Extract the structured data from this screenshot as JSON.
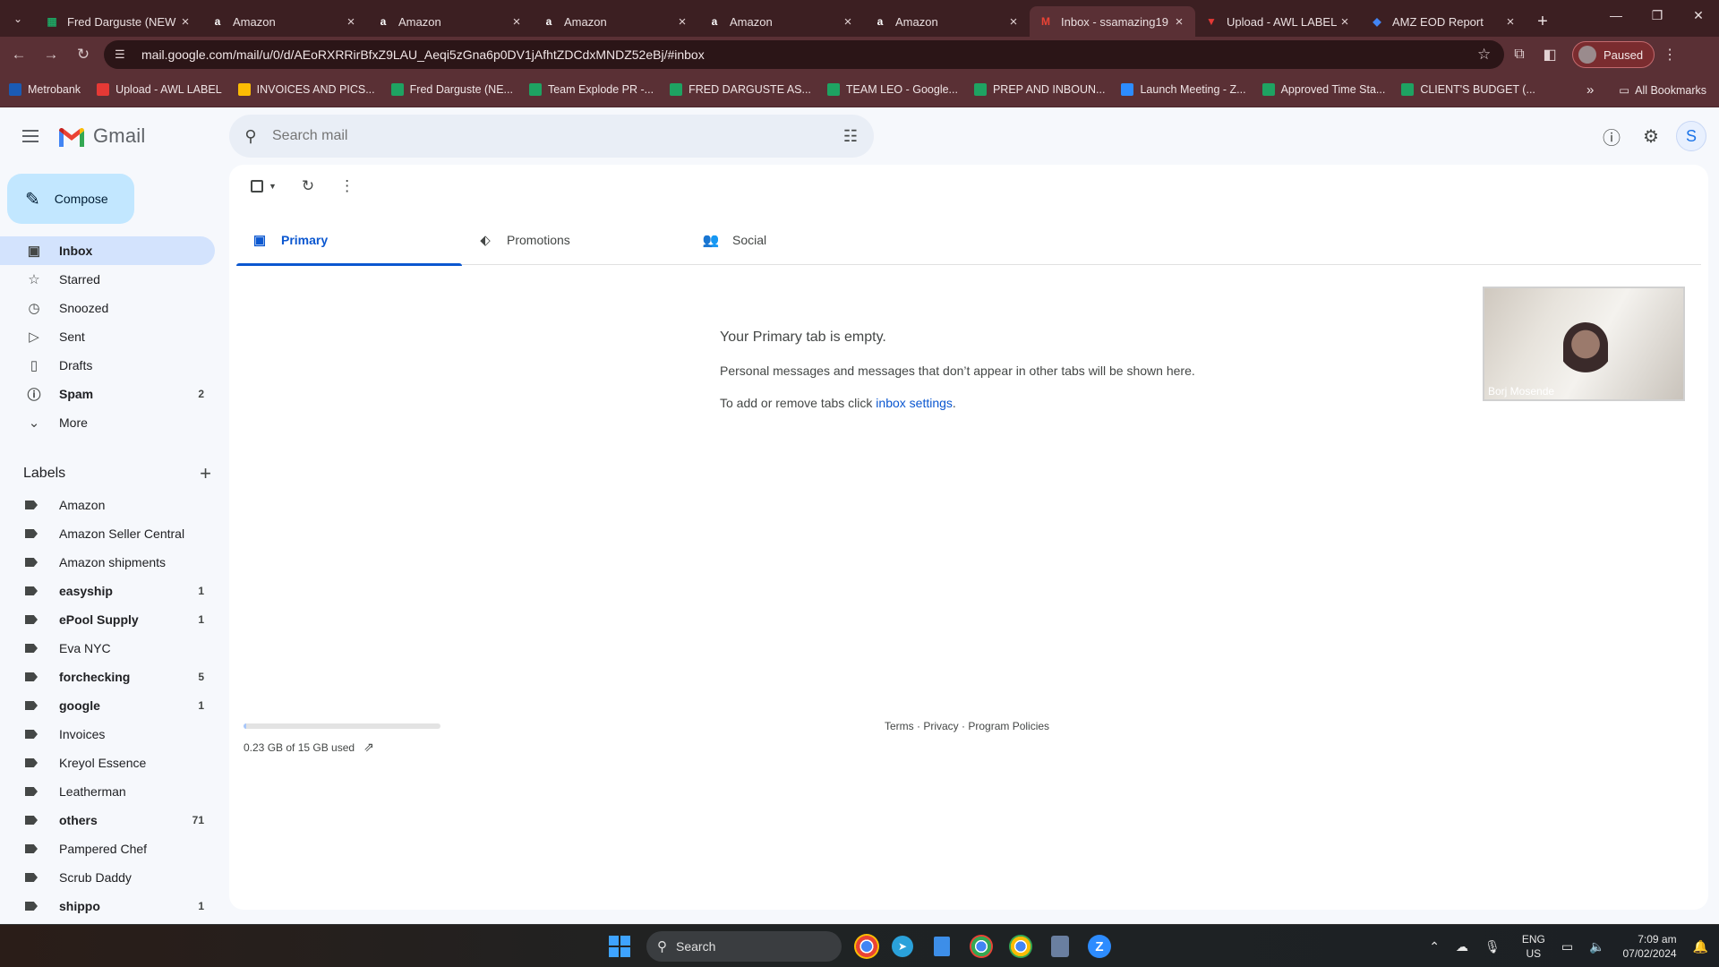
{
  "browser": {
    "tabs": [
      {
        "title": "Fred Darguste (NEW",
        "favicon": "sheets-icon",
        "color": "#1ea362",
        "active": false
      },
      {
        "title": "Amazon",
        "favicon": "amazon-icon",
        "color": "#ffffff",
        "active": false
      },
      {
        "title": "Amazon",
        "favicon": "amazon-icon",
        "color": "#ffffff",
        "active": false
      },
      {
        "title": "Amazon",
        "favicon": "amazon-icon",
        "color": "#ffffff",
        "active": false
      },
      {
        "title": "Amazon",
        "favicon": "amazon-icon",
        "color": "#ffffff",
        "active": false
      },
      {
        "title": "Amazon",
        "favicon": "amazon-icon",
        "color": "#ffffff",
        "active": false
      },
      {
        "title": "Inbox - ssamazing19",
        "favicon": "gmail-icon",
        "color": "#ea4335",
        "active": true
      },
      {
        "title": "Upload - AWL LABEL",
        "favicon": "awl-icon",
        "color": "#e53935",
        "active": false
      },
      {
        "title": "AMZ EOD Report",
        "favicon": "apps-script-icon",
        "color": "#4285f4",
        "active": false
      }
    ],
    "url": "mail.google.com/mail/u/0/d/AEoRXRRirBfxZ9LAU_Aeqi5zGna6p0DV1jAfhtZDCdxMNDZ52eBj/#inbox",
    "profile_status": "Paused",
    "bookmarks": [
      {
        "label": "Metrobank",
        "color": "#1a5bb5"
      },
      {
        "label": "Upload - AWL LABEL",
        "color": "#e53935"
      },
      {
        "label": "INVOICES AND PICS...",
        "color": "#fbbc04"
      },
      {
        "label": "Fred Darguste (NE...",
        "color": "#1ea362"
      },
      {
        "label": "Team Explode PR -...",
        "color": "#1ea362"
      },
      {
        "label": "FRED DARGUSTE AS...",
        "color": "#1ea362"
      },
      {
        "label": "TEAM LEO - Google...",
        "color": "#1ea362"
      },
      {
        "label": "PREP AND INBOUN...",
        "color": "#1ea362"
      },
      {
        "label": "Launch Meeting - Z...",
        "color": "#2d8cff"
      },
      {
        "label": "Approved Time Sta...",
        "color": "#1ea362"
      },
      {
        "label": "CLIENT'S BUDGET (...",
        "color": "#1ea362"
      }
    ],
    "all_bookmarks": "All Bookmarks"
  },
  "gmail": {
    "logo_text": "Gmail",
    "search_placeholder": "Search mail",
    "account_initial": "S",
    "compose": "Compose",
    "nav": [
      {
        "label": "Inbox",
        "icon": "inbox-icon",
        "glyph": "▣",
        "count": "",
        "active": true,
        "bold": true
      },
      {
        "label": "Starred",
        "icon": "star-icon",
        "glyph": "☆",
        "count": "",
        "active": false,
        "bold": false
      },
      {
        "label": "Snoozed",
        "icon": "clock-icon",
        "glyph": "◷",
        "count": "",
        "active": false,
        "bold": false
      },
      {
        "label": "Sent",
        "icon": "send-icon",
        "glyph": "▷",
        "count": "",
        "active": false,
        "bold": false
      },
      {
        "label": "Drafts",
        "icon": "draft-icon",
        "glyph": "▯",
        "count": "",
        "active": false,
        "bold": false
      },
      {
        "label": "Spam",
        "icon": "spam-icon",
        "glyph": "ⓘ",
        "count": "2",
        "active": false,
        "bold": true
      },
      {
        "label": "More",
        "icon": "chevron-down-icon",
        "glyph": "⌄",
        "count": "",
        "active": false,
        "bold": false
      }
    ],
    "labels_title": "Labels",
    "labels": [
      {
        "label": "Amazon",
        "count": "",
        "bold": false
      },
      {
        "label": "Amazon Seller Central",
        "count": "",
        "bold": false
      },
      {
        "label": "Amazon shipments",
        "count": "",
        "bold": false
      },
      {
        "label": "easyship",
        "count": "1",
        "bold": true
      },
      {
        "label": "ePool Supply",
        "count": "1",
        "bold": true
      },
      {
        "label": "Eva NYC",
        "count": "",
        "bold": false
      },
      {
        "label": "forchecking",
        "count": "5",
        "bold": true
      },
      {
        "label": "google",
        "count": "1",
        "bold": true
      },
      {
        "label": "Invoices",
        "count": "",
        "bold": false
      },
      {
        "label": "Kreyol Essence",
        "count": "",
        "bold": false
      },
      {
        "label": "Leatherman",
        "count": "",
        "bold": false
      },
      {
        "label": "others",
        "count": "71",
        "bold": true
      },
      {
        "label": "Pampered Chef",
        "count": "",
        "bold": false
      },
      {
        "label": "Scrub Daddy",
        "count": "",
        "bold": false
      },
      {
        "label": "shippo",
        "count": "1",
        "bold": true
      }
    ],
    "tabs": [
      {
        "label": "Primary",
        "icon": "inbox-tab-icon",
        "glyph": "▣",
        "active": true
      },
      {
        "label": "Promotions",
        "icon": "tag-icon",
        "glyph": "⬖",
        "active": false
      },
      {
        "label": "Social",
        "icon": "people-icon",
        "glyph": "👥",
        "active": false
      }
    ],
    "empty": {
      "title": "Your Primary tab is empty.",
      "line1": "Personal messages and messages that don’t appear in other tabs will be shown here.",
      "line2_prefix": "To add or remove tabs click ",
      "line2_link": "inbox settings",
      "line2_suffix": "."
    },
    "storage": {
      "text": "0.23 GB of 15 GB used",
      "used_fraction": 0.015
    },
    "footer": {
      "terms": "Terms",
      "privacy": "Privacy",
      "policies": "Program Policies",
      "sep": " · "
    },
    "video_participant": "Borj Mosende"
  },
  "taskbar": {
    "search": "Search",
    "lang_top": "ENG",
    "lang_bottom": "US",
    "time": "7:09 am",
    "date": "07/02/2024"
  }
}
